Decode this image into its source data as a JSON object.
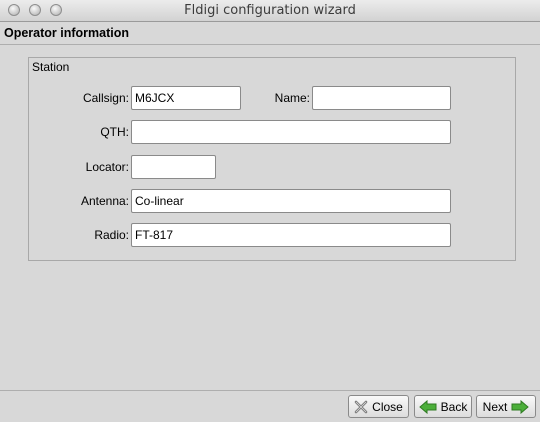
{
  "window": {
    "title": "Fldigi configuration wizard"
  },
  "page": {
    "title": "Operator information"
  },
  "station": {
    "group_label": "Station",
    "callsign_label": "Callsign:",
    "callsign_value": "M6JCX",
    "name_label": "Name:",
    "name_value": "",
    "qth_label": "QTH:",
    "qth_value": "",
    "locator_label": "Locator:",
    "locator_value": "",
    "antenna_label": "Antenna:",
    "antenna_value": "Co-linear",
    "radio_label": "Radio:",
    "radio_value": "FT-817"
  },
  "buttons": {
    "close_label": "Close",
    "back_label": "Back",
    "next_label": "Next"
  },
  "colors": {
    "arrow_green": "#4caf3a",
    "close_icon": "#6a6a6a"
  }
}
